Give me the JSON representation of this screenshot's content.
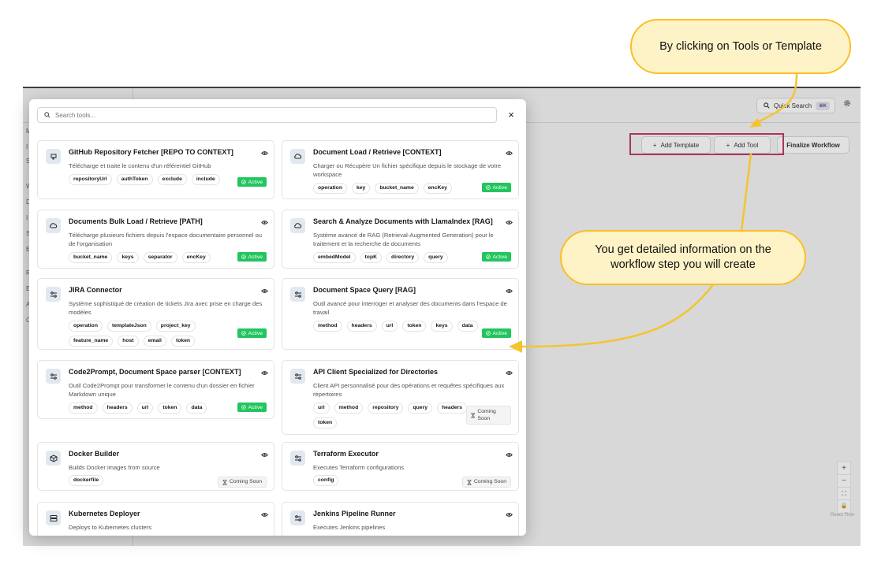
{
  "background_app": {
    "quick_search_label": "Quick Search",
    "quick_search_shortcut": "⌘K",
    "settings_icon": "gear-icon",
    "toolbar": {
      "add_template_label": "Add Template",
      "add_tool_label": "Add Tool",
      "finalize_label": "Finalize Workflow"
    },
    "zoom_controls": {
      "zoom_in": "+",
      "zoom_out": "−",
      "fit_view": "⛶",
      "lock": "🔒"
    },
    "react_flow_label": "React Flow"
  },
  "modal": {
    "search_placeholder": "Search tools...",
    "close_label": "×",
    "tools": [
      {
        "title": "GitHub Repository Fetcher [REPO TO CONTEXT]",
        "description": "Télécharge et traite le contenu d'un référentiel GitHub",
        "tags": [
          "repositoryUrl",
          "authToken",
          "exclude",
          "include"
        ],
        "status": "Active",
        "icon": "github-icon"
      },
      {
        "title": "Document Load / Retrieve [CONTEXT]",
        "description": "Charger ou Récupère Un fichier spécifique depuis le stockage de votre workspace",
        "tags": [
          "operation",
          "key",
          "bucket_name",
          "encKey"
        ],
        "status": "Active",
        "icon": "cloud-icon"
      },
      {
        "title": "Documents Bulk Load / Retrieve [PATH]",
        "description": "Télécharge plusieurs fichiers depuis l'espace documentaire personnel ou de l'organisation",
        "tags": [
          "bucket_name",
          "keys",
          "separator",
          "encKey"
        ],
        "status": "Active",
        "icon": "cloud-icon"
      },
      {
        "title": "Search & Analyze Documents with LlamaIndex [RAG]",
        "description": "Système avancé de RAG (Retrieval-Augmented Generation) pour le traitement et la recherche de documents",
        "tags": [
          "embedModel",
          "topK",
          "directory",
          "query"
        ],
        "status": "Active",
        "icon": "cloud-icon"
      },
      {
        "title": "JIRA Connector",
        "description": "Système sophistiqué de création de tickets Jira avec prise en charge des modèles",
        "tags": [
          "operation",
          "templateJson",
          "project_key",
          "feature_name",
          "host",
          "email",
          "token"
        ],
        "status": "Active",
        "icon": "settings-sliders-icon"
      },
      {
        "title": "Document Space Query [RAG]",
        "description": "Outil avancé pour interroger et analyser des documents dans l'espace de travail",
        "tags": [
          "method",
          "headers",
          "url",
          "token",
          "keys",
          "data"
        ],
        "status": "Active",
        "icon": "settings-sliders-icon"
      },
      {
        "title": "Code2Prompt, Document Space parser [CONTEXT]",
        "description": "Outil Code2Prompt pour transformer le contenu d'un dossier en fichier Markdown unique",
        "tags": [
          "method",
          "headers",
          "url",
          "token",
          "data"
        ],
        "status": "Active",
        "icon": "settings-sliders-icon"
      },
      {
        "title": "API Client Specialized for Directories",
        "description": "Client API personnalisé pour des opérations et requêtes spécifiques aux répertoires",
        "tags": [
          "url",
          "method",
          "repository",
          "query",
          "headers",
          "token"
        ],
        "status": "Coming Soon",
        "icon": "settings-sliders-icon"
      },
      {
        "title": "Docker Builder",
        "description": "Builds Docker images from source",
        "tags": [
          "dockerfile"
        ],
        "status": "Coming Soon",
        "icon": "box-icon"
      },
      {
        "title": "Terraform Executor",
        "description": "Executes Terraform configurations",
        "tags": [
          "config"
        ],
        "status": "Coming Soon",
        "icon": "settings-sliders-icon"
      },
      {
        "title": "Kubernetes Deployer",
        "description": "Deploys to Kubernetes clusters",
        "tags": [],
        "status": "",
        "icon": "server-icon"
      },
      {
        "title": "Jenkins Pipeline Runner",
        "description": "Executes Jenkins pipelines",
        "tags": [],
        "status": "",
        "icon": "settings-sliders-icon"
      }
    ]
  },
  "callouts": {
    "top": "By clicking on Tools or Template",
    "middle": "You get detailed information on the workflow step you will create"
  },
  "colors": {
    "active_green": "#22c55e",
    "highlight_border": "#b8235a",
    "callout_fill": "#fef3c7",
    "callout_border": "#fbbf24",
    "arrow": "#f4c430"
  }
}
